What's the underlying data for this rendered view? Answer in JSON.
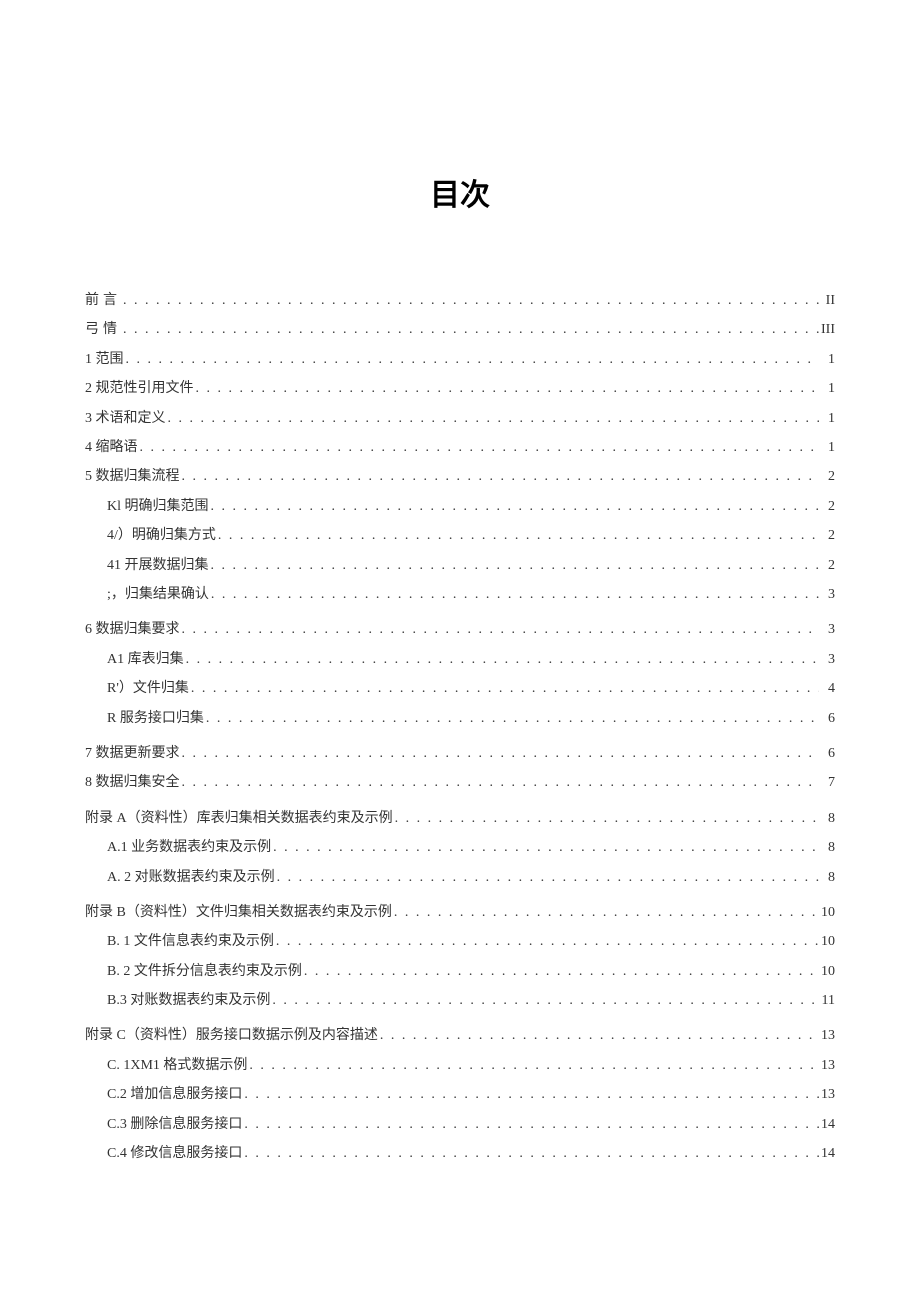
{
  "title": "目次",
  "items": [
    {
      "label": "前言",
      "pg": "II",
      "indent": 0,
      "gap": false,
      "ls": true
    },
    {
      "label": "弓情",
      "pg": "III",
      "indent": 0,
      "gap": false,
      "ls": true
    },
    {
      "label": "1 范围",
      "pg": "1",
      "indent": 0,
      "gap": false
    },
    {
      "label": "2 规范性引用文件",
      "pg": "1",
      "indent": 0,
      "gap": false
    },
    {
      "label": "3 术语和定义",
      "pg": "1",
      "indent": 0,
      "gap": false
    },
    {
      "label": "4 缩略语",
      "pg": "1",
      "indent": 0,
      "gap": false
    },
    {
      "label": "5 数据归集流程",
      "pg": "2",
      "indent": 0,
      "gap": false
    },
    {
      "label": "Kl 明确归集范围",
      "pg": "2",
      "indent": 1,
      "gap": false
    },
    {
      "label": "4/）明确归集方式",
      "pg": "2",
      "indent": 1,
      "gap": false
    },
    {
      "label": "41 开展数据归集",
      "pg": "2",
      "indent": 1,
      "gap": false
    },
    {
      "label": ";，归集结果确认",
      "pg": "3",
      "indent": 1,
      "gap": false
    },
    {
      "label": "6 数据归集要求",
      "pg": "3",
      "indent": 0,
      "gap": true
    },
    {
      "label": "A1 库表归集",
      "pg": "3",
      "indent": 1,
      "gap": false
    },
    {
      "label": "R'）文件归集",
      "pg": "4",
      "indent": 1,
      "gap": false
    },
    {
      "label": "R 服务接口归集",
      "pg": "6",
      "indent": 1,
      "gap": false
    },
    {
      "label": "7 数据更新要求",
      "pg": "6",
      "indent": 0,
      "gap": true
    },
    {
      "label": "8 数据归集安全",
      "pg": "7",
      "indent": 0,
      "gap": false
    },
    {
      "label": "附录 A（资料性）库表归集相关数据表约束及示例",
      "pg": "8",
      "indent": 0,
      "gap": true
    },
    {
      "label": "A.1 业务数据表约束及示例",
      "pg": "8",
      "indent": 1,
      "gap": false
    },
    {
      "label": "A.   2 对账数据表约束及示例",
      "pg": "8",
      "indent": 1,
      "gap": false
    },
    {
      "label": "附录 B（资料性）文件归集相关数据表约束及示例",
      "pg": "10",
      "indent": 0,
      "gap": true
    },
    {
      "label": "B.   1 文件信息表约束及示例",
      "pg": "10",
      "indent": 1,
      "gap": false
    },
    {
      "label": "B.   2 文件拆分信息表约束及示例",
      "pg": "10",
      "indent": 1,
      "gap": false
    },
    {
      "label": "B.3 对账数据表约束及示例",
      "pg": "11",
      "indent": 1,
      "gap": false
    },
    {
      "label": "附录 C（资料性）服务接口数据示例及内容描述",
      "pg": "13",
      "indent": 0,
      "gap": true
    },
    {
      "label": "C.   1XM1 格式数据示例",
      "pg": "13",
      "indent": 1,
      "gap": false
    },
    {
      "label": "C.2 增加信息服务接口",
      "pg": "13",
      "indent": 1,
      "gap": false
    },
    {
      "label": "C.3 删除信息服务接口",
      "pg": "14",
      "indent": 1,
      "gap": false
    },
    {
      "label": "C.4 修改信息服务接口",
      "pg": "14",
      "indent": 1,
      "gap": false
    }
  ]
}
